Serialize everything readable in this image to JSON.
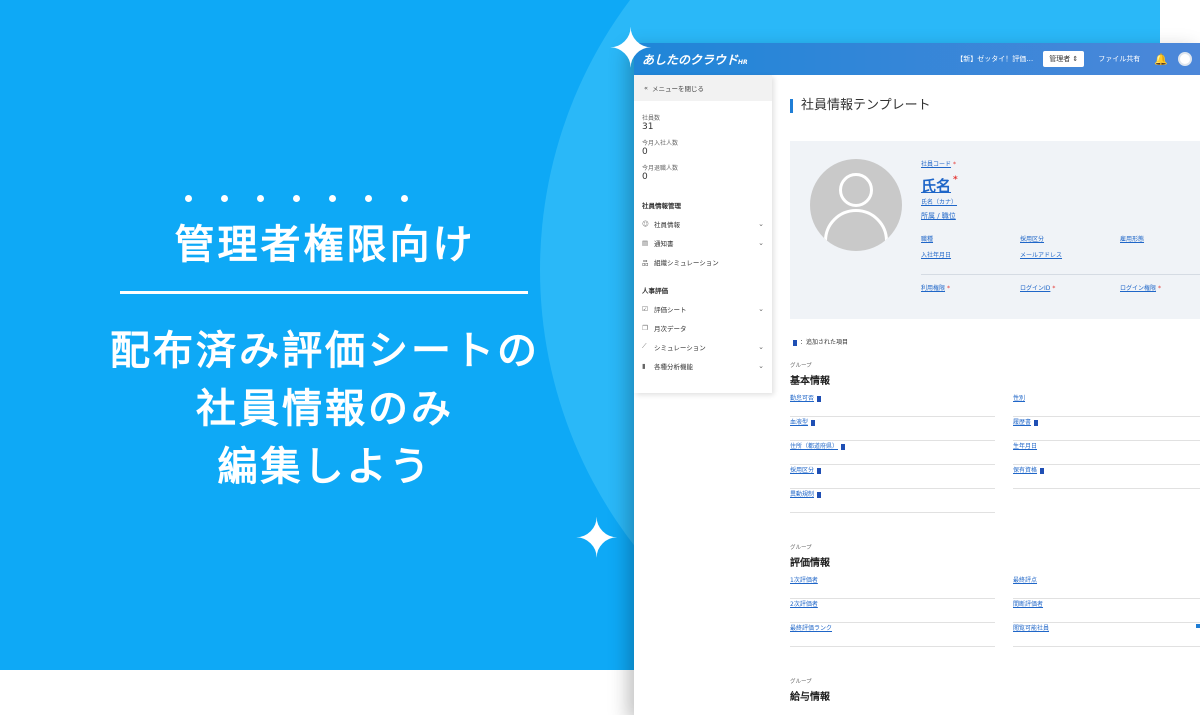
{
  "hero": {
    "kicker": "管理者権限向け",
    "line1": "配布済み評価シートの",
    "line2": "社員情報のみ",
    "line3": "編集しよう"
  },
  "colors": {
    "banner": "#0ea9f6",
    "accent": "#1f7ed6",
    "link": "#1f66c8",
    "required": "#e53935"
  },
  "topbar": {
    "logo": "あしたのクラウド",
    "logo_suffix": "HR",
    "notice": "【新】ゼッタイ！評価…",
    "role": "管理者 ⇕",
    "file_share": "ファイル共有",
    "bell_icon": "bell-icon"
  },
  "sidebar": {
    "close_menu": "メニューを閉じる",
    "stats": [
      {
        "label": "社員数",
        "value": "31"
      },
      {
        "label": "今月入社人数",
        "value": "0"
      },
      {
        "label": "今月退職人数",
        "value": "0"
      }
    ],
    "sections": [
      {
        "title": "社員情報管理",
        "items": [
          {
            "icon": "person-icon",
            "label": "社員情報",
            "chevron": true
          },
          {
            "icon": "document-icon",
            "label": "通知書",
            "chevron": true
          },
          {
            "icon": "org-chart-icon",
            "label": "組織シミュレーション",
            "chevron": false
          }
        ]
      },
      {
        "title": "人事評価",
        "items": [
          {
            "icon": "checklist-icon",
            "label": "評価シート",
            "chevron": true
          },
          {
            "icon": "copy-icon",
            "label": "月次データ",
            "chevron": false
          },
          {
            "icon": "simulation-icon",
            "label": "シミュレーション",
            "chevron": true
          },
          {
            "icon": "bar-chart-icon",
            "label": "各種分析機能",
            "chevron": true
          }
        ]
      }
    ]
  },
  "main": {
    "page_title": "社員情報テンプレート",
    "profile": {
      "employee_code": "社員コード",
      "name": "氏名",
      "name_kana": "氏名（カナ）",
      "dept_title": "所属 / 職位",
      "field1": "職種",
      "field2": "採用区分",
      "field3": "雇用形態",
      "field4": "入社年月日",
      "field5": "メールアドレス",
      "usage": "利用権限",
      "login_id": "ログインID",
      "login_auth": "ログイン権限",
      "required_mark": "*"
    },
    "legend": "：追加された項目",
    "group_label": "グループ",
    "groups": [
      {
        "title": "基本情報",
        "left": [
          "勤怠可否",
          "血液型",
          "住所（都道府県）",
          "採用区分",
          "異動規制"
        ],
        "right": [
          "性別",
          "履歴書",
          "生年月日",
          "保有資格"
        ]
      },
      {
        "title": "評価情報",
        "left": [
          "1次評価者",
          "2次評価者",
          "最終評価ランク"
        ],
        "right": [
          "最終評点",
          "間断評価者",
          "閲覧可能社員"
        ]
      },
      {
        "title": "給与情報"
      }
    ]
  }
}
